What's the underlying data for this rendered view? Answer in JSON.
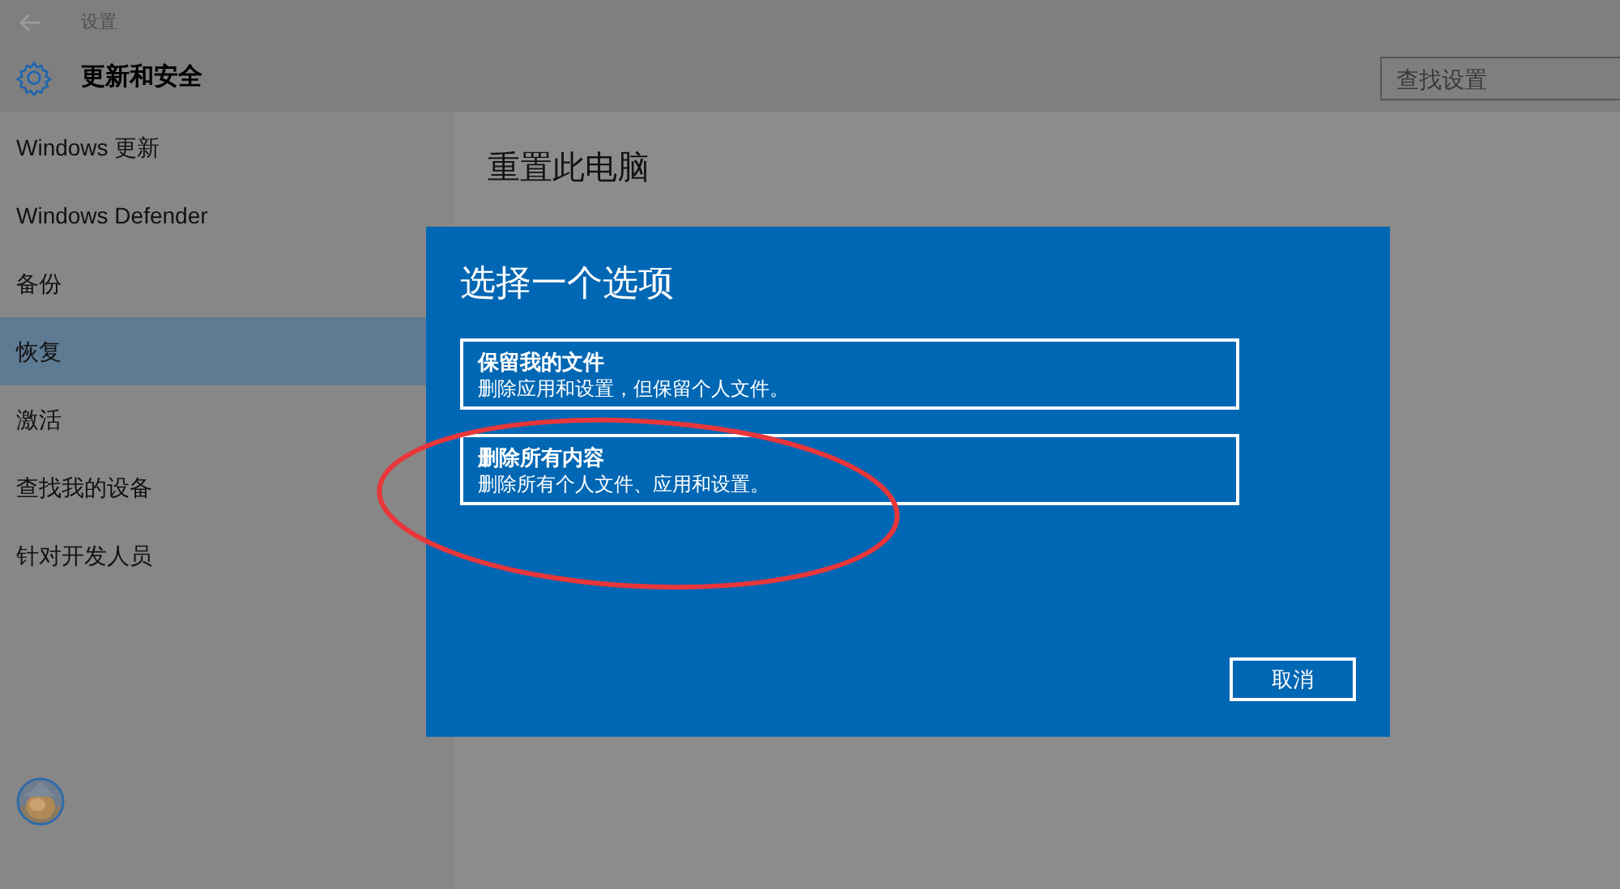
{
  "window": {
    "title": "设置"
  },
  "header": {
    "title": "更新和安全"
  },
  "search": {
    "placeholder": "查找设置"
  },
  "sidebar": {
    "items": [
      {
        "label": "Windows 更新",
        "selected": false
      },
      {
        "label": "Windows Defender",
        "selected": false
      },
      {
        "label": "备份",
        "selected": false
      },
      {
        "label": "恢复",
        "selected": true
      },
      {
        "label": "激活",
        "selected": false
      },
      {
        "label": "查找我的设备",
        "selected": false
      },
      {
        "label": "针对开发人员",
        "selected": false
      }
    ]
  },
  "content": {
    "title": "重置此电脑"
  },
  "dialog": {
    "title": "选择一个选项",
    "options": [
      {
        "title": "保留我的文件",
        "description": "删除应用和设置，但保留个人文件。"
      },
      {
        "title": "删除所有内容",
        "description": "删除所有个人文件、应用和设置。"
      }
    ],
    "cancel": "取消"
  }
}
